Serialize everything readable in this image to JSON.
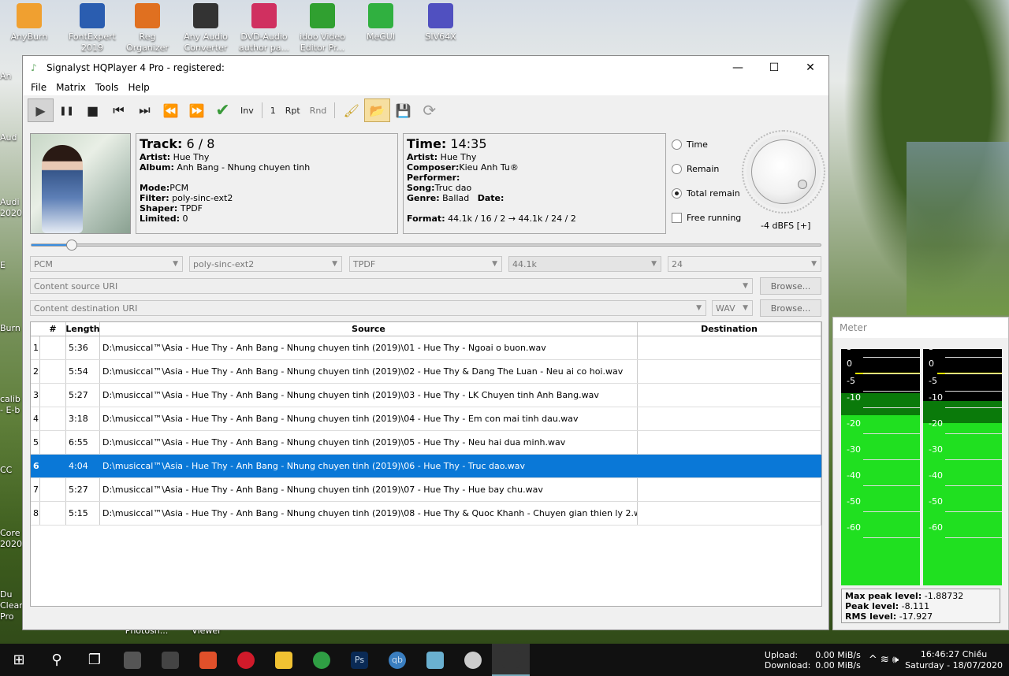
{
  "desktop": {
    "icons": [
      {
        "label": "AnyBurn",
        "color": "#f0a030"
      },
      {
        "label": "FontExpert 2019",
        "color": "#2a5db0"
      },
      {
        "label": "Reg Organizer",
        "color": "#e07020"
      },
      {
        "label": "Any Audio Converter",
        "color": "#333333"
      },
      {
        "label": "DVD-Audio author pa...",
        "color": "#d03060"
      },
      {
        "label": "idoo Video Editor Pr...",
        "color": "#30a030"
      },
      {
        "label": "MeGUI",
        "color": "#30b040"
      },
      {
        "label": "SIV64X",
        "color": "#5050c0"
      }
    ],
    "left_icons": [
      "An",
      "Aud",
      "Audi 2020",
      "E",
      "Burn",
      "calib - E-b",
      "CC",
      "Core 2020",
      "Du Cleaner Pro"
    ],
    "bottom_labels": [
      "Photosh...",
      "Viewer"
    ]
  },
  "window": {
    "title": "Signalyst HQPlayer 4 Pro - registered:",
    "minimize": "—",
    "maximize": "☐",
    "close": "✕",
    "menu": [
      "File",
      "Matrix",
      "Tools",
      "Help"
    ]
  },
  "toolbar": {
    "play": "▶",
    "pause": "❚❚",
    "stop": "■",
    "prev": "⏮",
    "next": "⏭",
    "rewind": "⏪",
    "forward": "⏩",
    "check": "✔",
    "inv": "Inv",
    "one": "1",
    "rpt": "Rpt",
    "rnd": "Rnd",
    "brush": "🖌",
    "open": "📂",
    "save": "💾",
    "refresh": "⟳"
  },
  "track": {
    "heading": "Track:",
    "value": "6 / 8",
    "artist_label": "Artist:",
    "artist": "Hue Thy",
    "album_label": "Album:",
    "album": "Anh Bang - Nhung chuyen tinh",
    "mode_label": "Mode:",
    "mode": "PCM",
    "filter_label": "Filter:",
    "filter": "poly-sinc-ext2",
    "shaper_label": "Shaper:",
    "shaper": "TPDF",
    "limited_label": "Limited:",
    "limited": "0"
  },
  "time": {
    "heading": "Time:",
    "value": "14:35",
    "artist_label": "Artist:",
    "artist": "Hue Thy",
    "composer_label": "Composer:",
    "composer": "Kieu Anh Tu®",
    "performer_label": "Performer:",
    "performer": "",
    "song_label": "Song:",
    "song": "Truc dao",
    "genre_label": "Genre:",
    "genre": "Ballad",
    "date_label": "Date:",
    "date": "",
    "format_label": "Format:",
    "format": "44.1k / 16 / 2 → 44.1k / 24 / 2"
  },
  "display_mode": {
    "time": "Time",
    "remain": "Remain",
    "total_remain": "Total remain",
    "free_running": "Free running",
    "selected": "Total remain"
  },
  "volume": {
    "label": "-4 dBFS [+]"
  },
  "progress": {
    "fraction": 0.05
  },
  "settings": {
    "mode": "PCM",
    "filter": "poly-sinc-ext2",
    "shaper": "TPDF",
    "rate": "44.1k",
    "bits": "24"
  },
  "source_uri": {
    "placeholder": "Content source URI",
    "browse": "Browse..."
  },
  "dest_uri": {
    "placeholder": "Content destination URI",
    "format": "WAV",
    "browse": "Browse..."
  },
  "playlist": {
    "headers": {
      "num": "#",
      "length": "Length",
      "source": "Source",
      "destination": "Destination"
    },
    "selected": 6,
    "rows": [
      {
        "n": "1",
        "length": "5:36",
        "source": "D:\\musiccal™\\Asia - Hue Thy - Anh Bang - Nhung chuyen tinh (2019)\\01 - Hue Thy - Ngoai o buon.wav"
      },
      {
        "n": "2",
        "length": "5:54",
        "source": "D:\\musiccal™\\Asia - Hue Thy - Anh Bang - Nhung chuyen tinh (2019)\\02 - Hue Thy & Dang The Luan - Neu ai co hoi.wav"
      },
      {
        "n": "3",
        "length": "5:27",
        "source": "D:\\musiccal™\\Asia - Hue Thy - Anh Bang - Nhung chuyen tinh (2019)\\03 - Hue Thy - LK Chuyen tinh Anh Bang.wav"
      },
      {
        "n": "4",
        "length": "3:18",
        "source": "D:\\musiccal™\\Asia - Hue Thy - Anh Bang - Nhung chuyen tinh (2019)\\04 - Hue Thy - Em con mai tinh dau.wav"
      },
      {
        "n": "5",
        "length": "6:55",
        "source": "D:\\musiccal™\\Asia - Hue Thy - Anh Bang - Nhung chuyen tinh (2019)\\05 - Hue Thy - Neu hai dua minh.wav"
      },
      {
        "n": "6",
        "length": "4:04",
        "source": "D:\\musiccal™\\Asia - Hue Thy - Anh Bang - Nhung chuyen tinh (2019)\\06 - Hue Thy - Truc dao.wav"
      },
      {
        "n": "7",
        "length": "5:27",
        "source": "D:\\musiccal™\\Asia - Hue Thy - Anh Bang - Nhung chuyen tinh (2019)\\07 - Hue Thy - Hue bay chu.wav"
      },
      {
        "n": "8",
        "length": "5:15",
        "source": "D:\\musiccal™\\Asia - Hue Thy - Anh Bang - Nhung chuyen tinh (2019)\\08 - Hue Thy & Quoc Khanh - Chuyen gian thien ly 2.wav"
      }
    ]
  },
  "meter": {
    "title": "Meter",
    "scale": [
      "5",
      "0",
      "-5",
      "-10",
      "-20",
      "-30",
      "-40",
      "-50",
      "-60"
    ],
    "channels": [
      {
        "peak_db": -1.9,
        "level_db": -8.1
      },
      {
        "peak_db": -1.9,
        "level_db": -10.5
      }
    ],
    "max_peak_label": "Max peak level:",
    "max_peak": "-1.88732",
    "peak_label": "Peak level:",
    "peak": "-8.111",
    "rms_label": "RMS level:",
    "rms": "-17.927"
  },
  "taskbar": {
    "start": "⊞",
    "search": "⚲",
    "taskview": "❐",
    "apps": [
      {
        "name": "app1",
        "color": "#555"
      },
      {
        "name": "app2",
        "color": "#444"
      },
      {
        "name": "brave",
        "color": "#e0502a"
      },
      {
        "name": "opera",
        "color": "#d01a2a"
      },
      {
        "name": "explorer",
        "color": "#f1c232"
      },
      {
        "name": "chrome",
        "color": "#2f9e44"
      },
      {
        "name": "photoshop",
        "color": "#0a2a55"
      },
      {
        "name": "qbittorrent",
        "color": "#3a7ec0"
      },
      {
        "name": "app9",
        "color": "#6ab0d0"
      },
      {
        "name": "dvd",
        "color": "#cccccc"
      },
      {
        "name": "hqplayer",
        "color": "#333333"
      }
    ],
    "ps_label": "Ps",
    "qb_label": "qb",
    "upload_label": "Upload:",
    "upload": "0.00 MiB/s",
    "download_label": "Download:",
    "download": "0.00 MiB/s",
    "tray_icons": "^ ≋ 🕪",
    "time": "16:46:27 Chiều",
    "date": "Saturday - 18/07/2020"
  }
}
